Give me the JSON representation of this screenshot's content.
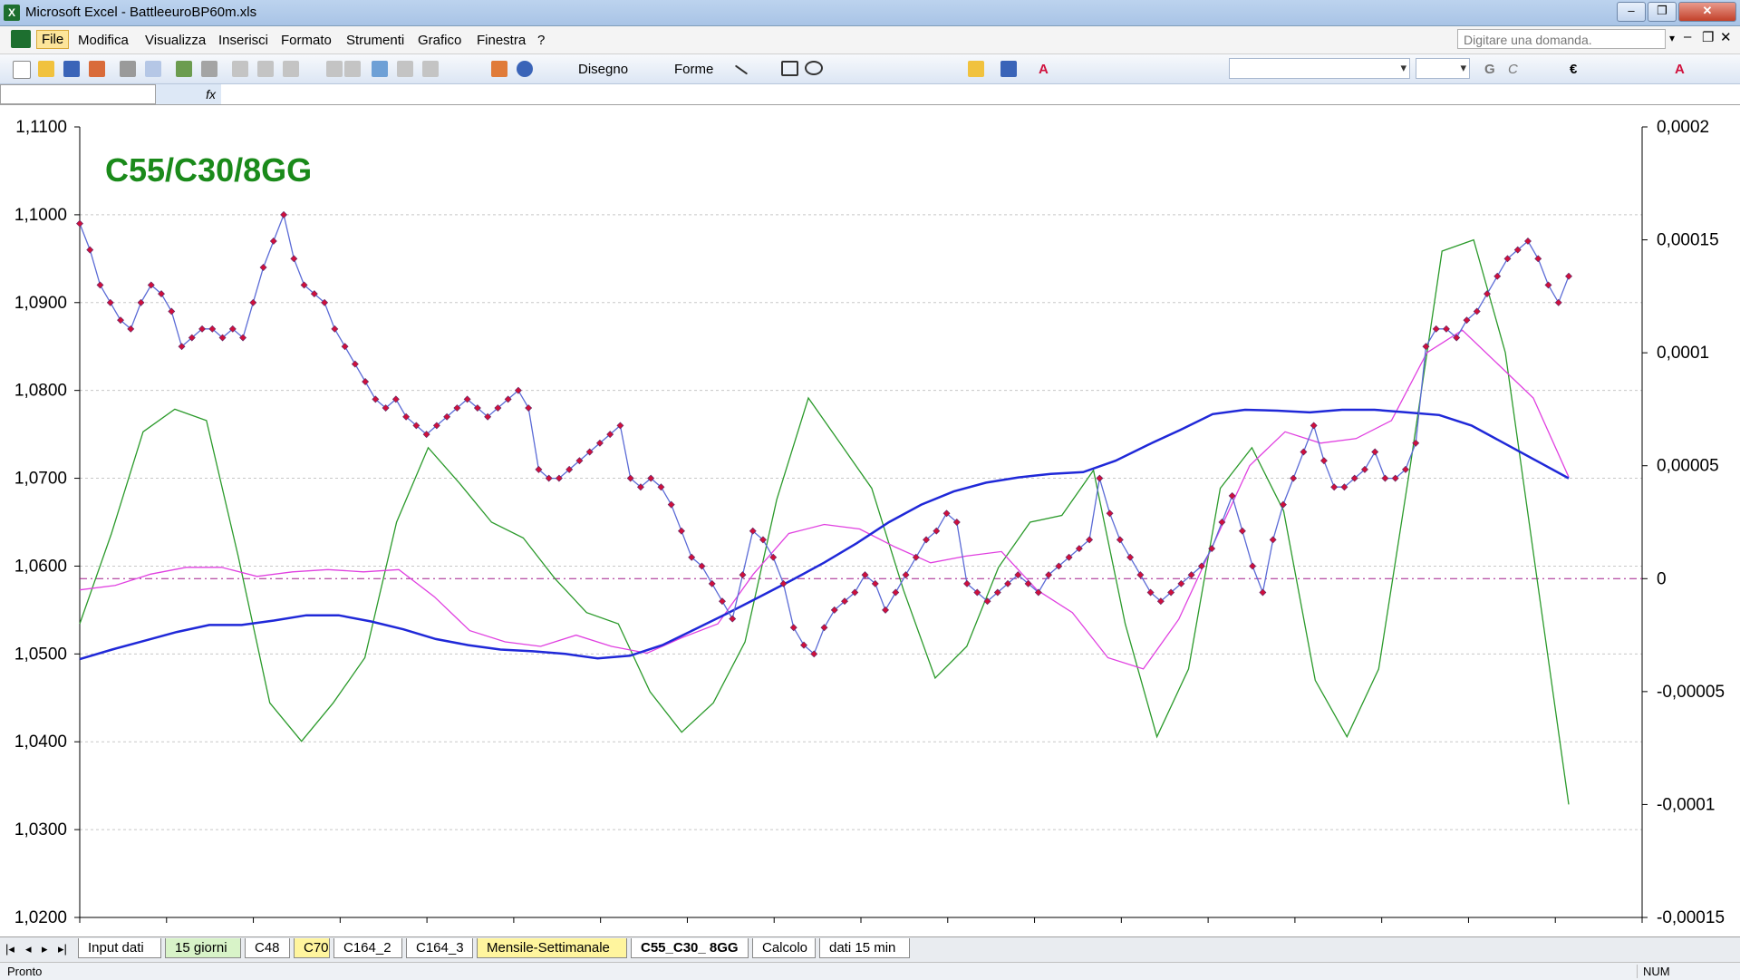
{
  "window": {
    "title": "Microsoft Excel - BattleeuroBP60m.xls",
    "app_badge": "X",
    "min": "–",
    "max": "❐",
    "close": "✕"
  },
  "menu": {
    "items": [
      "File",
      "Modifica",
      "Visualizza",
      "Inserisci",
      "Formato",
      "Strumenti",
      "Grafico",
      "Finestra",
      "?"
    ],
    "help_placeholder": "Digitare una domanda."
  },
  "toolbar": {
    "draw_label": "Disegno",
    "shapes_label": "Forme",
    "icons": [
      "new-icon",
      "open-icon",
      "save-icon",
      "permission-icon",
      "print-icon",
      "print-preview-icon",
      "spelling-icon",
      "research-icon",
      "cut-icon",
      "copy-icon",
      "paste-icon",
      "undo-icon",
      "redo-icon",
      "hyperlink-icon",
      "sum-icon",
      "sort-icon",
      "chart-wizard-icon",
      "help-icon"
    ]
  },
  "formula": {
    "fx": "fx"
  },
  "sheets": {
    "tabs": [
      {
        "label": "Input dati",
        "style": "plain"
      },
      {
        "label": "15 giorni",
        "style": "green"
      },
      {
        "label": "C48",
        "style": "plain"
      },
      {
        "label": "C70",
        "style": "yellow"
      },
      {
        "label": "C164_2",
        "style": "plain"
      },
      {
        "label": "C164_3",
        "style": "plain"
      },
      {
        "label": "Mensile-Settimanale",
        "style": "yellow"
      },
      {
        "label": "C55_C30_ 8GG",
        "style": "active"
      },
      {
        "label": "Calcolo",
        "style": "plain"
      },
      {
        "label": "dati 15 min",
        "style": "plain"
      }
    ]
  },
  "status": {
    "left": "Pronto",
    "num": "NUM"
  },
  "colors": {
    "price": "#5b6bd6",
    "marker": "#d0103c",
    "blue": "#1f28d8",
    "magenta": "#e040e0",
    "green": "#2b9a2b",
    "zero_line": "#a01a8a",
    "title": "#1a8a1a"
  },
  "chart_data": {
    "type": "line",
    "title": "C55/C30/8GG",
    "ylim_left": [
      1.02,
      1.11
    ],
    "ylim_right": [
      -0.00015,
      0.0002
    ],
    "left_ticks": [
      "1,1100",
      "1,1000",
      "1,0900",
      "1,0800",
      "1,0700",
      "1,0600",
      "1,0500",
      "1,0400",
      "1,0300",
      "1,0200"
    ],
    "right_ticks": [
      "0,0002",
      "0,00015",
      "0,0001",
      "0,00005",
      "0",
      "-0,00005",
      "-0,0001",
      "-0,00015"
    ],
    "grid": true,
    "series": [
      {
        "axis": "left",
        "values": [
          1.099,
          1.096,
          1.092,
          1.09,
          1.088,
          1.087,
          1.09,
          1.092,
          1.091,
          1.089,
          1.085,
          1.086,
          1.087,
          1.087,
          1.086,
          1.087,
          1.086,
          1.09,
          1.094,
          1.097,
          1.1,
          1.095,
          1.092,
          1.091,
          1.09,
          1.087,
          1.085,
          1.083,
          1.081,
          1.079,
          1.078,
          1.079,
          1.077,
          1.076,
          1.075,
          1.076,
          1.077,
          1.078,
          1.079,
          1.078,
          1.077,
          1.078,
          1.079,
          1.08,
          1.078,
          1.071,
          1.07,
          1.07,
          1.071,
          1.072,
          1.073,
          1.074,
          1.075,
          1.076,
          1.07,
          1.069,
          1.07,
          1.069,
          1.067,
          1.064,
          1.061,
          1.06,
          1.058,
          1.056,
          1.054,
          1.059,
          1.064,
          1.063,
          1.061,
          1.058,
          1.053,
          1.051,
          1.05,
          1.053,
          1.055,
          1.056,
          1.057,
          1.059,
          1.058,
          1.055,
          1.057,
          1.059,
          1.061,
          1.063,
          1.064,
          1.066,
          1.065,
          1.058,
          1.057,
          1.056,
          1.057,
          1.058,
          1.059,
          1.058,
          1.057,
          1.059,
          1.06,
          1.061,
          1.062,
          1.063,
          1.07,
          1.066,
          1.063,
          1.061,
          1.059,
          1.057,
          1.056,
          1.057,
          1.058,
          1.059,
          1.06,
          1.062,
          1.065,
          1.068,
          1.064,
          1.06,
          1.057,
          1.063,
          1.067,
          1.07,
          1.073,
          1.076,
          1.072,
          1.069,
          1.069,
          1.07,
          1.071,
          1.073,
          1.07,
          1.07,
          1.071,
          1.074,
          1.085,
          1.087,
          1.087,
          1.086,
          1.088,
          1.089,
          1.091,
          1.093,
          1.095,
          1.096,
          1.097,
          1.095,
          1.092,
          1.09,
          1.093
        ]
      },
      {
        "axis": "left",
        "values": [
          1.0494,
          1.0505,
          1.0515,
          1.0525,
          1.0533,
          1.0533,
          1.0538,
          1.0544,
          1.0544,
          1.0537,
          1.0528,
          1.0517,
          1.051,
          1.0505,
          1.0503,
          1.05,
          1.0495,
          1.0498,
          1.051,
          1.0528,
          1.0546,
          1.0565,
          1.0584,
          1.0604,
          1.0626,
          1.065,
          1.067,
          1.0685,
          1.0695,
          1.0701,
          1.0705,
          1.0707,
          1.072,
          1.0738,
          1.0755,
          1.0773,
          1.0778,
          1.0777,
          1.0775,
          1.0778,
          1.0778,
          1.0775,
          1.0772,
          1.076,
          1.074,
          1.072,
          1.07
        ]
      },
      {
        "axis": "right",
        "values": [
          -5e-06,
          -3e-06,
          2e-06,
          5e-06,
          5e-06,
          1e-06,
          3e-06,
          4e-06,
          3e-06,
          4e-06,
          -8e-06,
          -2.3e-05,
          -2.8e-05,
          -3e-05,
          -2.5e-05,
          -3e-05,
          -3.3e-05,
          -2.6e-05,
          -2e-05,
          2e-06,
          2e-05,
          2.4e-05,
          2.2e-05,
          1.4e-05,
          7e-06,
          1e-05,
          1.2e-05,
          -5e-06,
          -1.5e-05,
          -3.5e-05,
          -4e-05,
          -1.8e-05,
          1.6e-05,
          5e-05,
          6.5e-05,
          6e-05,
          6.2e-05,
          7e-05,
          0.0001,
          0.00011,
          9.5e-05,
          8e-05,
          4.5e-05
        ]
      },
      {
        "axis": "right",
        "values": [
          -2e-05,
          2e-05,
          6.5e-05,
          7.5e-05,
          7e-05,
          1e-05,
          -5.5e-05,
          -7.2e-05,
          -5.5e-05,
          -3.5e-05,
          2.5e-05,
          5.8e-05,
          4.2e-05,
          2.5e-05,
          1.8e-05,
          0.0,
          -1.5e-05,
          -2e-05,
          -5e-05,
          -6.8e-05,
          -5.5e-05,
          -2.8e-05,
          3.5e-05,
          8e-05,
          6e-05,
          4e-05,
          -5e-06,
          -4.4e-05,
          -3e-05,
          5e-06,
          2.5e-05,
          2.8e-05,
          4.8e-05,
          -2e-05,
          -7e-05,
          -4e-05,
          4e-05,
          5.8e-05,
          3e-05,
          -4.5e-05,
          -7e-05,
          -4e-05,
          5e-05,
          0.000145,
          0.00015,
          0.0001,
          0.0,
          -0.0001
        ]
      }
    ]
  }
}
